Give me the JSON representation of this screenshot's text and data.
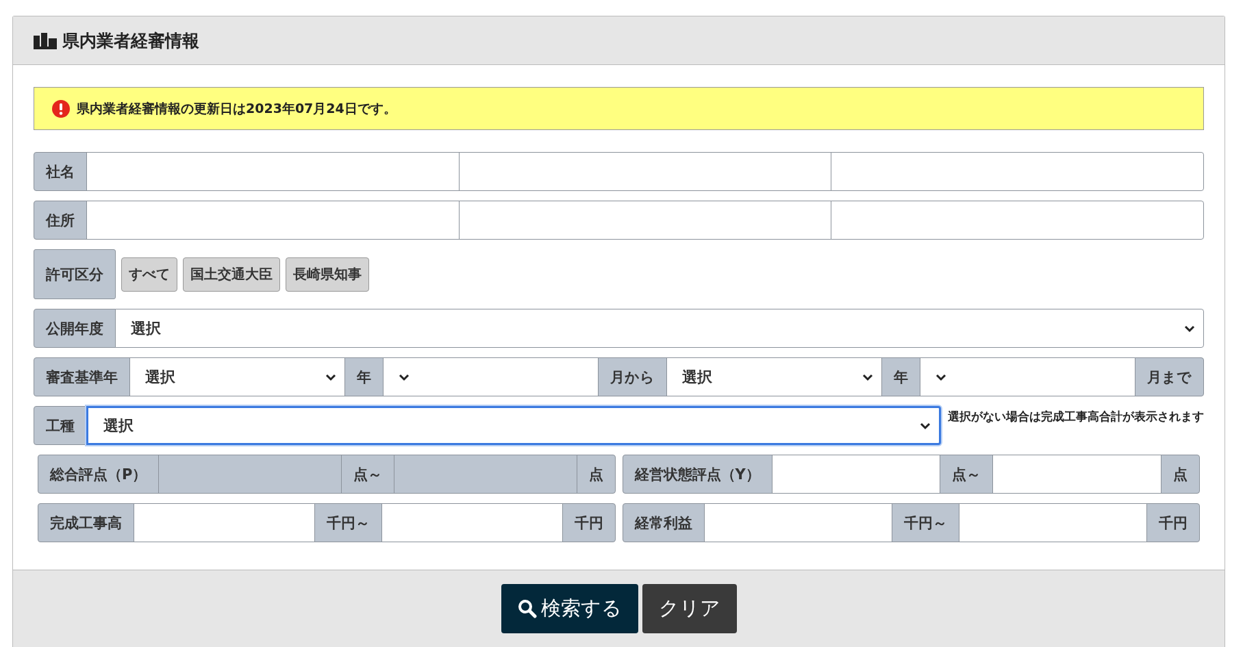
{
  "panel": {
    "title": "県内業者経審情報"
  },
  "notice": {
    "text": "県内業者経審情報の更新日は2023年07月24日です。"
  },
  "rows": [
    {
      "groups": [
        {
          "kind": "fields",
          "items": [
            {
              "kind": "label",
              "text": "社名"
            },
            {
              "kind": "input",
              "disabled": false
            },
            {
              "kind": "input",
              "disabled": false
            },
            {
              "kind": "input",
              "disabled": false
            }
          ]
        }
      ]
    },
    {
      "groups": [
        {
          "kind": "fields",
          "items": [
            {
              "kind": "label",
              "text": "住所"
            },
            {
              "kind": "input",
              "disabled": false
            },
            {
              "kind": "input",
              "disabled": false
            },
            {
              "kind": "input",
              "disabled": false
            }
          ]
        }
      ]
    },
    {
      "groups": [
        {
          "kind": "choices",
          "items": [
            {
              "kind": "label",
              "text": "許可区分"
            },
            {
              "kind": "option",
              "text": "すべて"
            },
            {
              "kind": "option",
              "text": "国土交通大臣"
            },
            {
              "kind": "option",
              "text": "長崎県知事"
            }
          ]
        }
      ]
    },
    {
      "groups": [
        {
          "kind": "fields",
          "items": [
            {
              "kind": "label",
              "text": "公開年度"
            },
            {
              "kind": "select",
              "value": "選択",
              "focused": false
            }
          ]
        }
      ]
    },
    {
      "groups": [
        {
          "kind": "fields",
          "items": [
            {
              "kind": "label",
              "text": "審査基準年"
            },
            {
              "kind": "select",
              "value": "選択",
              "focused": false
            },
            {
              "kind": "label",
              "text": "年"
            },
            {
              "kind": "select",
              "focused": false
            },
            {
              "kind": "label",
              "text": "月から"
            },
            {
              "kind": "select",
              "value": "選択",
              "focused": false
            },
            {
              "kind": "label",
              "text": "年"
            },
            {
              "kind": "select",
              "focused": false
            },
            {
              "kind": "label",
              "text": "月まで"
            }
          ]
        }
      ]
    },
    {
      "groups": [
        {
          "kind": "fields",
          "items": [
            {
              "kind": "label",
              "text": "工種"
            },
            {
              "kind": "select",
              "value": "選択",
              "focused": true
            }
          ]
        }
      ],
      "note": "選択がない場合は完成工事高合計が表示されます"
    },
    {
      "groups": [
        {
          "kind": "fields",
          "items": [
            {
              "kind": "label",
              "text": "総合評点（P）"
            },
            {
              "kind": "input",
              "disabled": true
            },
            {
              "kind": "label",
              "text": "点～"
            },
            {
              "kind": "input",
              "disabled": true
            },
            {
              "kind": "label",
              "text": "点"
            }
          ]
        },
        {
          "kind": "fields",
          "items": [
            {
              "kind": "label",
              "text": "経営状態評点（Y）"
            },
            {
              "kind": "input",
              "disabled": false
            },
            {
              "kind": "label",
              "text": "点～"
            },
            {
              "kind": "input",
              "disabled": false
            },
            {
              "kind": "label",
              "text": "点"
            }
          ]
        }
      ]
    },
    {
      "groups": [
        {
          "kind": "fields",
          "items": [
            {
              "kind": "label",
              "text": "完成工事高"
            },
            {
              "kind": "input",
              "disabled": false
            },
            {
              "kind": "label",
              "text": "千円～"
            },
            {
              "kind": "input",
              "disabled": false
            },
            {
              "kind": "label",
              "text": "千円"
            }
          ]
        },
        {
          "kind": "fields",
          "items": [
            {
              "kind": "label",
              "text": "経常利益"
            },
            {
              "kind": "input",
              "disabled": false
            },
            {
              "kind": "label",
              "text": "千円～"
            },
            {
              "kind": "input",
              "disabled": false
            },
            {
              "kind": "label",
              "text": "千円"
            }
          ]
        }
      ]
    }
  ],
  "buttons": [
    {
      "kind": "search",
      "label": "検索する"
    },
    {
      "kind": "clear",
      "label": "クリア"
    }
  ]
}
